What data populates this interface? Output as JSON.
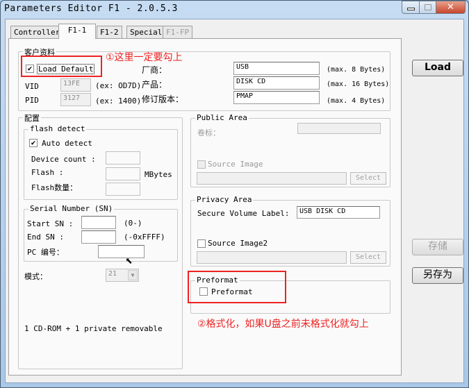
{
  "window": {
    "title": "Parameters Editor F1 - 2.0.5.3"
  },
  "tabs": [
    {
      "label": "Controller"
    },
    {
      "label": "F1-1"
    },
    {
      "label": "F1-2"
    },
    {
      "label": "Special"
    },
    {
      "label": "F1-FP"
    }
  ],
  "customer": {
    "title": "客户资料",
    "load_default": "Load Default",
    "vid_label": "VID",
    "vid_value": "13FE",
    "vid_hint": "(ex: OD7D)",
    "pid_label": "PID",
    "pid_value": "3127",
    "pid_hint": "(ex: 1400)",
    "vendor_label": "厂商：",
    "vendor_value": "USB",
    "vendor_hint": "(max. 8 Bytes)",
    "product_label": "产品：",
    "product_value": "DISK CD",
    "product_hint": "(max. 16 Bytes)",
    "revision_label": "修订版本：",
    "revision_value": "PMAP",
    "revision_hint": "(max. 4 Bytes)"
  },
  "config": {
    "title": "配置",
    "flash_detect": "flash detect",
    "auto_detect": "Auto detect",
    "device_count": "Device count :",
    "flash": "Flash :",
    "mbytes": "MBytes",
    "flash_count": "Flash数量：",
    "serial_title": "Serial Number (SN)",
    "start_sn": "Start SN :",
    "start_hint": "(0-)",
    "end_sn": "End SN :",
    "end_hint": "(-0xFFFF)",
    "pc_label": "PC 编号：",
    "mode_label": "模式：",
    "mode_value": "21",
    "summary": "1 CD-ROM + 1 private removable"
  },
  "public_area": {
    "title": "Public Area",
    "volume_label": "卷标：",
    "source_image": "Source Image",
    "select": "Select"
  },
  "privacy_area": {
    "title": "Privacy Area",
    "secure_label": "Secure Volume Label:",
    "secure_value": "USB DISK CD",
    "source_image2": "Source Image2",
    "select": "Select"
  },
  "preformat": {
    "title": "Preformat",
    "checkbox": "Preformat"
  },
  "buttons": {
    "load": "Load",
    "save": "存储",
    "save_as": "另存为"
  },
  "annotations": {
    "note1": "①这里一定要勾上",
    "note2": "②格式化，如果U盘之前未格式化就勾上"
  }
}
